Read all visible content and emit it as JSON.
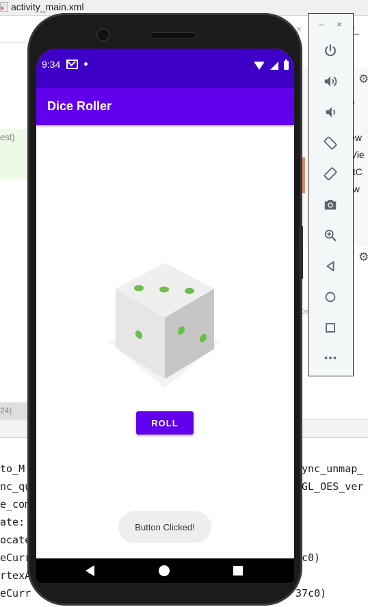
{
  "ide": {
    "file_tab": "activity_main.xml",
    "right_tab_fragment": "ity_",
    "left_green_text": "est)",
    "left_gray_text": "24)",
    "right_panel_rows": [
      "iew",
      "rVie",
      "ntC",
      "ew"
    ],
    "right_header_row": "w",
    "right_small_text": "0s",
    "console_left": [
      "to_M",
      "nc_qu",
      "e_com",
      "ate: ",
      "ocate",
      "eCurr",
      "rtexA",
      "eCurr"
    ],
    "console_right": [
      "ync_unmap_",
      "GL_OES_ver",
      "c0)",
      "37c0)"
    ]
  },
  "phone": {
    "status": {
      "time": "9:34"
    },
    "app": {
      "title": "Dice Roller",
      "roll_label": "ROLL",
      "toast_text": "Button Clicked!"
    }
  },
  "colors": {
    "status_bar": "#3e00c6",
    "app_bar": "#6200ee",
    "button": "#6200ee",
    "dice_pips": "#6bbf4a"
  },
  "emulator_toolbar": {
    "minimize_label": "−",
    "close_label": "×",
    "buttons": [
      {
        "name": "power-icon"
      },
      {
        "name": "volume-up-icon"
      },
      {
        "name": "volume-down-icon"
      },
      {
        "name": "rotate-left-icon"
      },
      {
        "name": "rotate-right-icon"
      },
      {
        "name": "camera-icon"
      },
      {
        "name": "zoom-icon"
      },
      {
        "name": "back-icon"
      },
      {
        "name": "home-icon"
      },
      {
        "name": "overview-icon"
      },
      {
        "name": "more-icon"
      }
    ]
  }
}
